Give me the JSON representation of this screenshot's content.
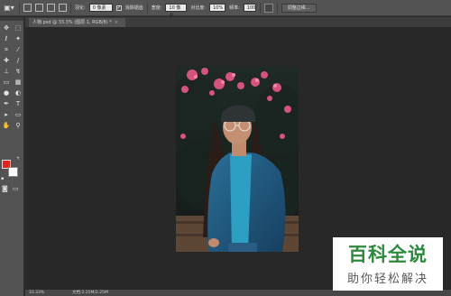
{
  "options_bar": {
    "tool_icon": "brush-preset-icon",
    "mode_label": "羽化:",
    "feather_value": "0 像素",
    "antialias_label": "消除锯齿",
    "antialias_checked": true,
    "width_label": "宽度:",
    "width_value": "10 像素",
    "contrast_label": "对比度:",
    "contrast_value": "10%",
    "frequency_label": "频率:",
    "frequency_value": "100",
    "refine_edge_label": "调整边缘..."
  },
  "toolbox": {
    "tools": [
      {
        "name": "move-tool-icon",
        "glyph": "✥"
      },
      {
        "name": "marquee-tool-icon",
        "glyph": "⬚"
      },
      {
        "name": "lasso-tool-icon",
        "glyph": "ℓ"
      },
      {
        "name": "magic-wand-tool-icon",
        "glyph": "✦"
      },
      {
        "name": "crop-tool-icon",
        "glyph": "⌗"
      },
      {
        "name": "eyedropper-tool-icon",
        "glyph": "⁄"
      },
      {
        "name": "healing-brush-tool-icon",
        "glyph": "✚"
      },
      {
        "name": "brush-tool-icon",
        "glyph": "/"
      },
      {
        "name": "clone-stamp-tool-icon",
        "glyph": "⊥"
      },
      {
        "name": "history-brush-tool-icon",
        "glyph": "↯"
      },
      {
        "name": "eraser-tool-icon",
        "glyph": "▭"
      },
      {
        "name": "gradient-tool-icon",
        "glyph": "▦"
      },
      {
        "name": "blur-tool-icon",
        "glyph": "●"
      },
      {
        "name": "dodge-tool-icon",
        "glyph": "◐"
      },
      {
        "name": "pen-tool-icon",
        "glyph": "✒"
      },
      {
        "name": "type-tool-icon",
        "glyph": "T"
      },
      {
        "name": "path-selection-tool-icon",
        "glyph": "▸"
      },
      {
        "name": "shape-tool-icon",
        "glyph": "▭"
      },
      {
        "name": "hand-tool-icon",
        "glyph": "✋"
      },
      {
        "name": "zoom-tool-icon",
        "glyph": "⚲"
      }
    ],
    "foreground_color": "#e8231f",
    "background_color": "#ffffff"
  },
  "document": {
    "tab_title": "人物.psd @ 33.3% (图层 1, RGB/8) *",
    "tab_close": "×"
  },
  "status_bar": {
    "zoom": "33.33%",
    "doc_info": "文档:2.25M/2.25M"
  },
  "watermark": {
    "title": "百科全说",
    "subtitle": "助你轻松解决"
  }
}
